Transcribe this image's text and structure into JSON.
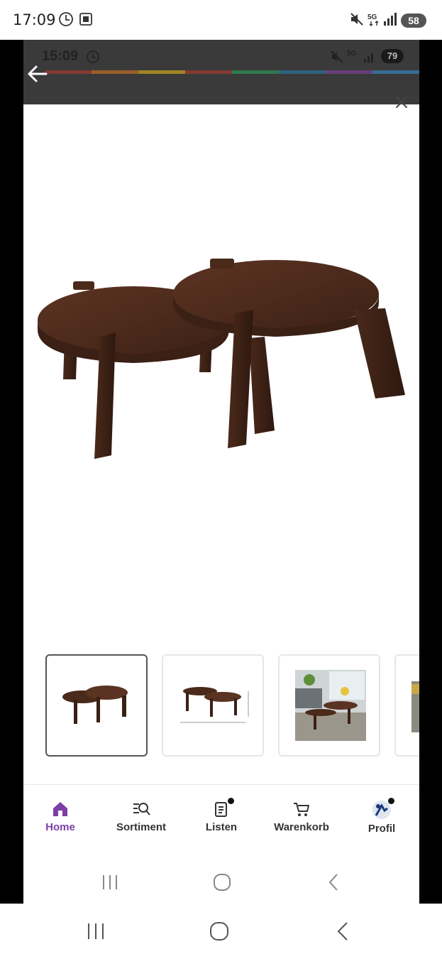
{
  "outer_status": {
    "time": "17:09",
    "battery": "58"
  },
  "inner_status": {
    "time": "15:09",
    "battery": "79"
  },
  "rainbow_colors": [
    "#c0392b",
    "#e67e22",
    "#f1c40f",
    "#c0392b",
    "#27ae60",
    "#2980b9",
    "#8e44ad",
    "#3498db"
  ],
  "product": {
    "image_icon": "nesting-coffee-tables-image"
  },
  "thumbnails": [
    {
      "name": "thumbnail-1",
      "selected": true
    },
    {
      "name": "thumbnail-2",
      "selected": false
    },
    {
      "name": "thumbnail-3",
      "selected": false
    },
    {
      "name": "thumbnail-4",
      "selected": false
    }
  ],
  "nav": {
    "home": "Home",
    "sortiment": "Sortiment",
    "listen": "Listen",
    "warenkorb": "Warenkorb",
    "profil": "Profil"
  },
  "colors": {
    "accent": "#7b3fa8",
    "wood": "#4a2a1a"
  }
}
